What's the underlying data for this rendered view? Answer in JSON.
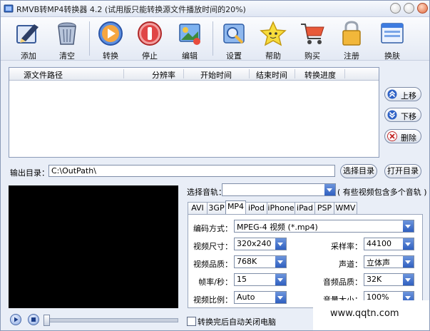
{
  "window": {
    "title": "RMVB转MP4转换器 4.2 (试用版只能转换源文件播放时间的20%)"
  },
  "toolbar": {
    "items": [
      {
        "label": "添加",
        "icon": "add-pen-icon"
      },
      {
        "label": "清空",
        "icon": "trash-can-icon"
      },
      {
        "label": "转换",
        "icon": "play-convert-icon"
      },
      {
        "label": "停止",
        "icon": "stop-icon"
      },
      {
        "label": "编辑",
        "icon": "edit-clip-icon"
      },
      {
        "label": "设置",
        "icon": "settings-tools-icon"
      },
      {
        "label": "帮助",
        "icon": "help-star-icon"
      },
      {
        "label": "购买",
        "icon": "shopping-cart-icon"
      },
      {
        "label": "注册",
        "icon": "lock-icon"
      },
      {
        "label": "换肤",
        "icon": "skin-window-icon"
      }
    ]
  },
  "filelist": {
    "columns": [
      "源文件路径",
      "分辨率",
      "开始时间",
      "结束时间",
      "转换进度"
    ],
    "rows": []
  },
  "side_buttons": {
    "up": "上移",
    "down": "下移",
    "delete": "删除"
  },
  "output": {
    "label": "输出目录：",
    "path": "C:\\OutPath\\",
    "choose_button": "选择目录",
    "open_button": "打开目录"
  },
  "audio": {
    "label": "选择音轨：",
    "value": "",
    "note": "( 有些视频包含多个音轨 )"
  },
  "format_tabs": {
    "tabs": [
      "AVI",
      "3GP",
      "MP4",
      "iPod",
      "iPhone",
      "iPad",
      "PSP",
      "WMV"
    ],
    "active": "MP4"
  },
  "settings": {
    "encoding_label": "编码方式：",
    "encoding_value": "MPEG-4 视频 (*.mp4)",
    "size_label": "视频尺寸：",
    "size_value": "320x240",
    "quality_label": "视频品质：",
    "quality_value": "768K",
    "fps_label": "帧率/秒：",
    "fps_value": "15",
    "ratio_label": "视频比例：",
    "ratio_value": "Auto",
    "samplerate_label": "采样率：",
    "samplerate_value": "44100",
    "channel_label": "声道：",
    "channel_value": "立体声",
    "audioquality_label": "音频品质：",
    "audioquality_value": "32K",
    "volume_label": "音量大小：",
    "volume_value": "100%"
  },
  "player": {
    "seek_fraction": 0.0
  },
  "auto_shutdown": {
    "label": "转换完后自动关闭电脑",
    "checked": false
  },
  "watermark": {
    "text": "www.qqtn.com"
  }
}
